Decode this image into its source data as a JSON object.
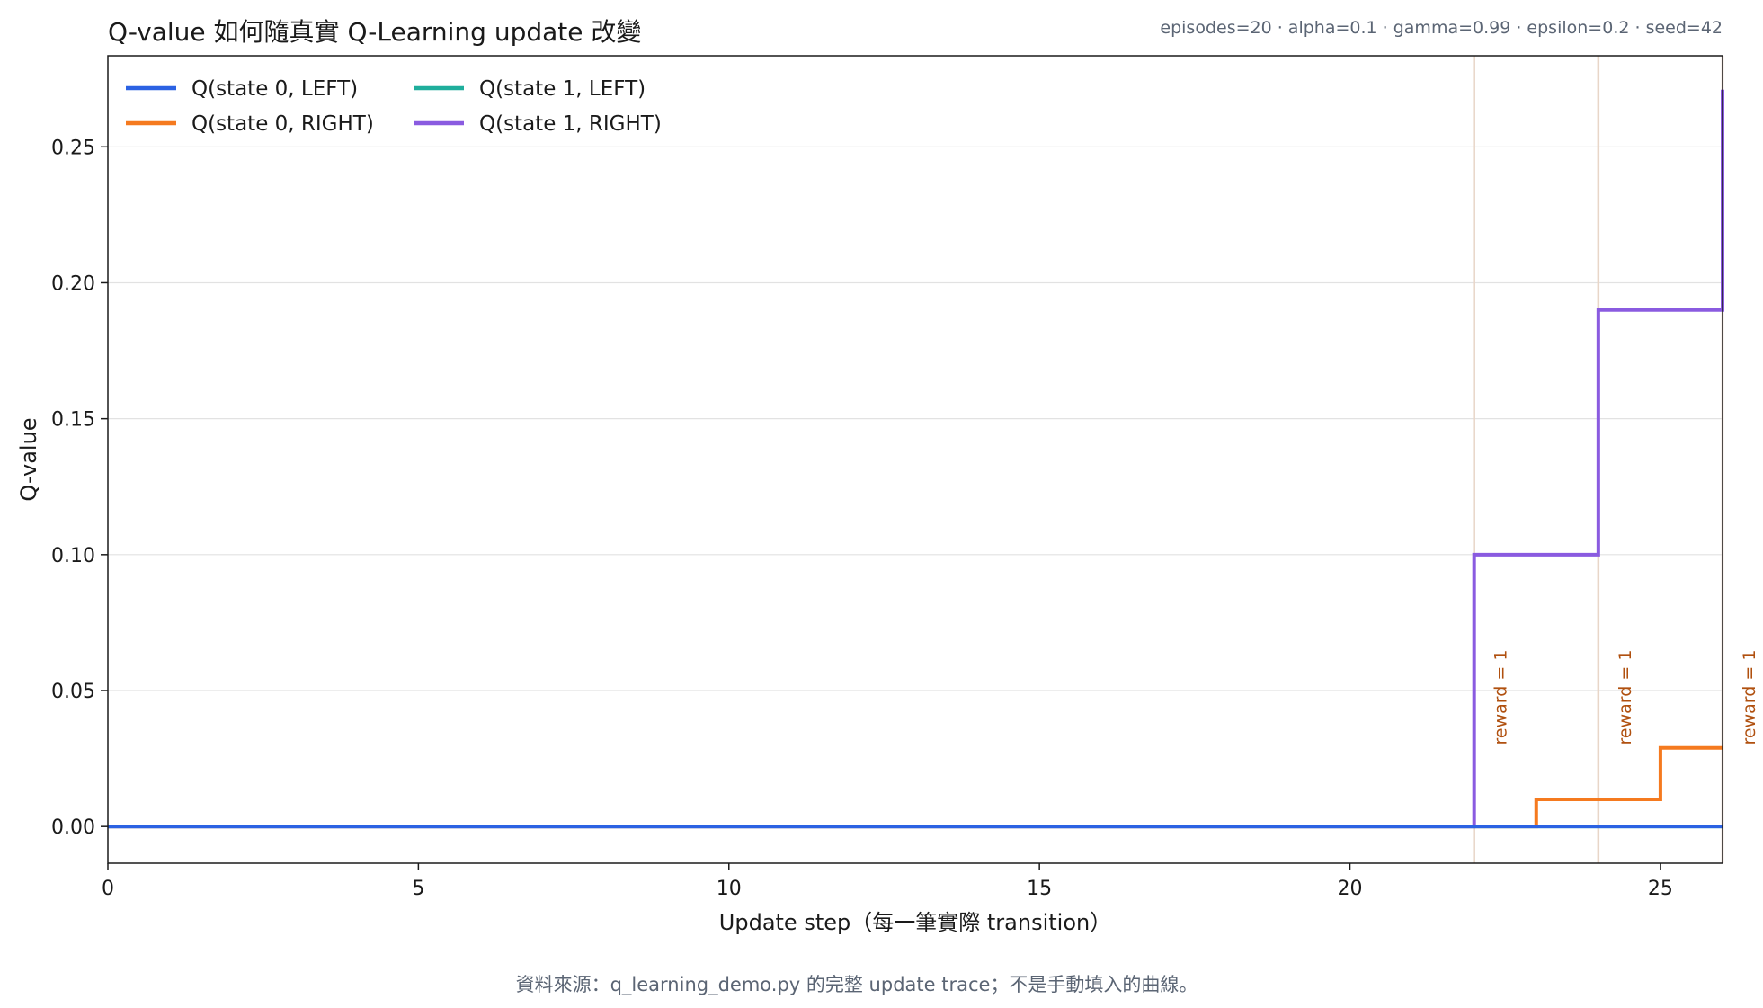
{
  "chart_data": {
    "type": "line",
    "step": "post",
    "title": "Q-value 如何隨真實 Q-Learning update 改變",
    "params_text": "episodes=20 · alpha=0.1 · gamma=0.99 · epsilon=0.2 · seed=42",
    "xlabel": "Update step（每一筆實際 transition）",
    "ylabel": "Q-value",
    "xlim": [
      0,
      26
    ],
    "ylim": [
      -0.0135,
      0.2835
    ],
    "xticks": [
      0,
      5,
      10,
      15,
      20,
      25
    ],
    "yticks": [
      0.0,
      0.05,
      0.1,
      0.15,
      0.2,
      0.25
    ],
    "ytick_labels": [
      "0.00",
      "0.05",
      "0.10",
      "0.15",
      "0.20",
      "0.25"
    ],
    "grid": "horizontal",
    "legend_position": "top-left",
    "series": [
      {
        "name": "Q(state 0, LEFT)",
        "color": "#2b62e3",
        "x": [
          0,
          26
        ],
        "y": [
          0,
          0
        ]
      },
      {
        "name": "Q(state 0, RIGHT)",
        "color": "#f57a1f",
        "x": [
          0,
          23,
          25,
          26
        ],
        "y": [
          0,
          0.01,
          0.0289,
          0.0289
        ]
      },
      {
        "name": "Q(state 1, LEFT)",
        "color": "#1fae9c",
        "x": [
          0,
          26
        ],
        "y": [
          0,
          0
        ]
      },
      {
        "name": "Q(state 1, RIGHT)",
        "color": "#8a5be0",
        "x": [
          0,
          22,
          24,
          26
        ],
        "y": [
          0,
          0.1,
          0.19,
          0.271
        ]
      }
    ],
    "draw_order": [
      1,
      2,
      3,
      0
    ],
    "reward_markers": [
      {
        "x": 22,
        "label": "reward = 1"
      },
      {
        "x": 24,
        "label": "reward = 1"
      },
      {
        "x": 26,
        "label": "reward = 1"
      }
    ],
    "marker_color": "#e8d6c8",
    "annotation_color": "#b0500f"
  },
  "footer": {
    "source_text": "資料來源：q_learning_demo.py 的完整 update trace；不是手動填入的曲線。"
  }
}
